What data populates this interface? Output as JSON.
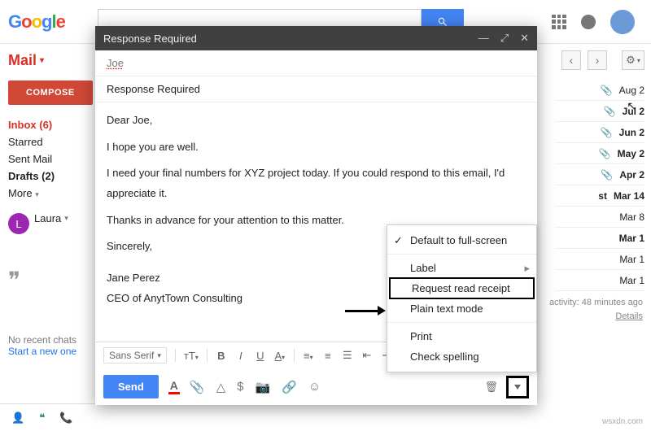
{
  "header": {
    "logo_letters": [
      "G",
      "o",
      "o",
      "g",
      "l",
      "e"
    ],
    "search_placeholder": ""
  },
  "sidebar": {
    "mail_label": "Mail",
    "compose": "COMPOSE",
    "items": [
      {
        "label": "Inbox (6)",
        "bold": true,
        "red": true
      },
      {
        "label": "Starred"
      },
      {
        "label": "Sent Mail"
      },
      {
        "label": "Drafts (2)",
        "bold": true
      },
      {
        "label": "More"
      }
    ],
    "user_initial": "L",
    "user_name": "Laura",
    "no_chats": "No recent chats",
    "start_new": "Start a new one"
  },
  "right": {
    "rows": [
      {
        "date": "Aug 2",
        "att": true
      },
      {
        "date": "Jul 2",
        "att": true,
        "bold": true
      },
      {
        "date": "Jun 2",
        "att": true,
        "bold": true
      },
      {
        "date": "May 2",
        "att": true,
        "bold": true
      },
      {
        "date": "Apr 2",
        "att": true,
        "bold": true
      },
      {
        "date": "Mar 14",
        "bold": true,
        "label": "st"
      },
      {
        "date": "Mar 8"
      },
      {
        "date": "Mar 1",
        "bold": true
      },
      {
        "date": "Mar 1"
      },
      {
        "date": "Mar 1"
      }
    ],
    "activity": "activity: 48 minutes ago",
    "details": "Details"
  },
  "compose": {
    "title": "Response Required",
    "to": "Joe",
    "subject": "Response Required",
    "body": {
      "greeting": "Dear Joe,",
      "line1": "I hope you are well.",
      "line2": "I need your final numbers for XYZ project today. If you could respond to this email, I'd appreciate it.",
      "line3": "Thanks in advance for your attention to this matter.",
      "closing": "Sincerely,",
      "sig1": "Jane Perez",
      "sig2": "CEO of AnytTown Consulting"
    },
    "font": "Sans Serif",
    "send": "Send"
  },
  "menu": {
    "fullscreen": "Default to full-screen",
    "label": "Label",
    "read_receipt": "Request read receipt",
    "plain": "Plain text mode",
    "print": "Print",
    "spell": "Check spelling"
  },
  "watermark": "wsxdn.com"
}
